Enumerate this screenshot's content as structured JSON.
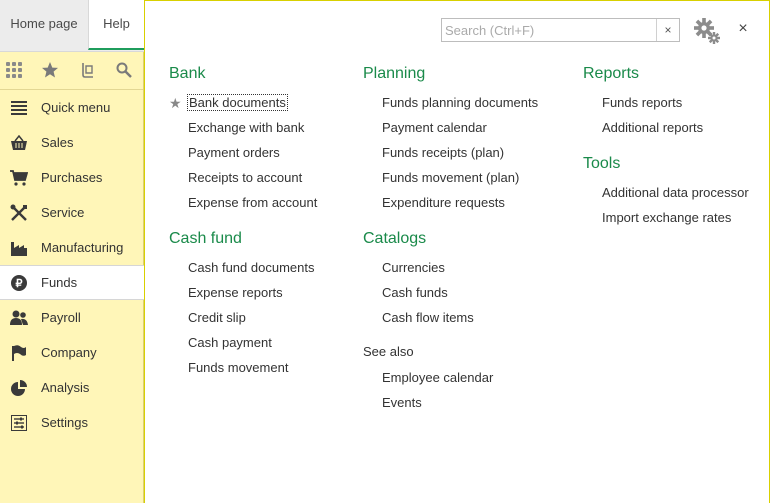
{
  "top_tabs": {
    "home": "Home page",
    "help": "Help"
  },
  "sidebar": {
    "tools": [
      {
        "icon": "grid-icon"
      },
      {
        "icon": "star-icon"
      },
      {
        "icon": "history-icon"
      },
      {
        "icon": "search-icon"
      }
    ],
    "sections": [
      {
        "label": "Quick menu",
        "icon": "menu-icon"
      },
      {
        "label": "Sales",
        "icon": "basket-icon"
      },
      {
        "label": "Purchases",
        "icon": "cart-icon"
      },
      {
        "label": "Service",
        "icon": "tools-icon"
      },
      {
        "label": "Manufacturing",
        "icon": "factory-icon"
      },
      {
        "label": "Funds",
        "icon": "coin-icon",
        "active": true
      },
      {
        "label": "Payroll",
        "icon": "people-icon"
      },
      {
        "label": "Company",
        "icon": "flag-icon"
      },
      {
        "label": "Analysis",
        "icon": "pie-icon"
      },
      {
        "label": "Settings",
        "icon": "sliders-icon"
      }
    ]
  },
  "search": {
    "placeholder": "Search (Ctrl+F)",
    "value": "",
    "clear": "×"
  },
  "close_label": "×",
  "groups": {
    "bank": {
      "title": "Bank",
      "items": [
        "Bank documents",
        "Exchange with bank",
        "Payment orders",
        "Receipts to account",
        "Expense from account"
      ]
    },
    "cash_fund": {
      "title": "Cash fund",
      "items": [
        "Cash fund documents",
        "Expense reports",
        "Credit slip",
        "Cash payment",
        "Funds movement"
      ]
    },
    "planning": {
      "title": "Planning",
      "items": [
        "Funds planning documents",
        "Payment calendar",
        "Funds receipts (plan)",
        "Funds movement (plan)",
        "Expenditure requests"
      ]
    },
    "catalogs": {
      "title": "Catalogs",
      "items": [
        "Currencies",
        "Cash funds",
        "Cash flow items"
      ]
    },
    "see_also": {
      "title": "See also",
      "items": [
        "Employee calendar",
        "Events"
      ]
    },
    "reports": {
      "title": "Reports",
      "items": [
        "Funds reports",
        "Additional reports"
      ]
    },
    "tools": {
      "title": "Tools",
      "items": [
        "Additional data processor",
        "Import exchange rates"
      ]
    }
  },
  "colors": {
    "accent_green": "#1a8a4a",
    "sidebar_bg": "#fff6b8",
    "panel_border": "#d8d000"
  }
}
